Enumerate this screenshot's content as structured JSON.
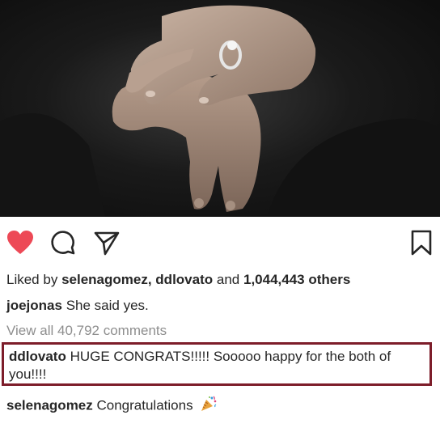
{
  "post": {
    "image_alt": "Hands with engagement ring",
    "actions": {
      "like_icon": "heart-filled-icon",
      "comment_icon": "comment-icon",
      "share_icon": "share-paper-plane-icon",
      "save_icon": "bookmark-icon",
      "like_color": "#ed4956"
    },
    "likes": {
      "prefix": "Liked by",
      "user1": "selenagomez,",
      "user2": "ddlovato",
      "and": "and",
      "count": "1,044,443 others"
    },
    "caption": {
      "user": "joejonas",
      "text": "She said yes."
    },
    "view_comments": "View all 40,792 comments",
    "comments": [
      {
        "user": "ddlovato",
        "text": "HUGE CONGRATS!!!!! Sooooo happy for the both of you!!!!",
        "highlighted": true,
        "highlight_color": "#7d1d2a"
      },
      {
        "user": "selenagomez",
        "text": "Congratulations",
        "emoji_icon": "party-popper-icon"
      }
    ]
  }
}
